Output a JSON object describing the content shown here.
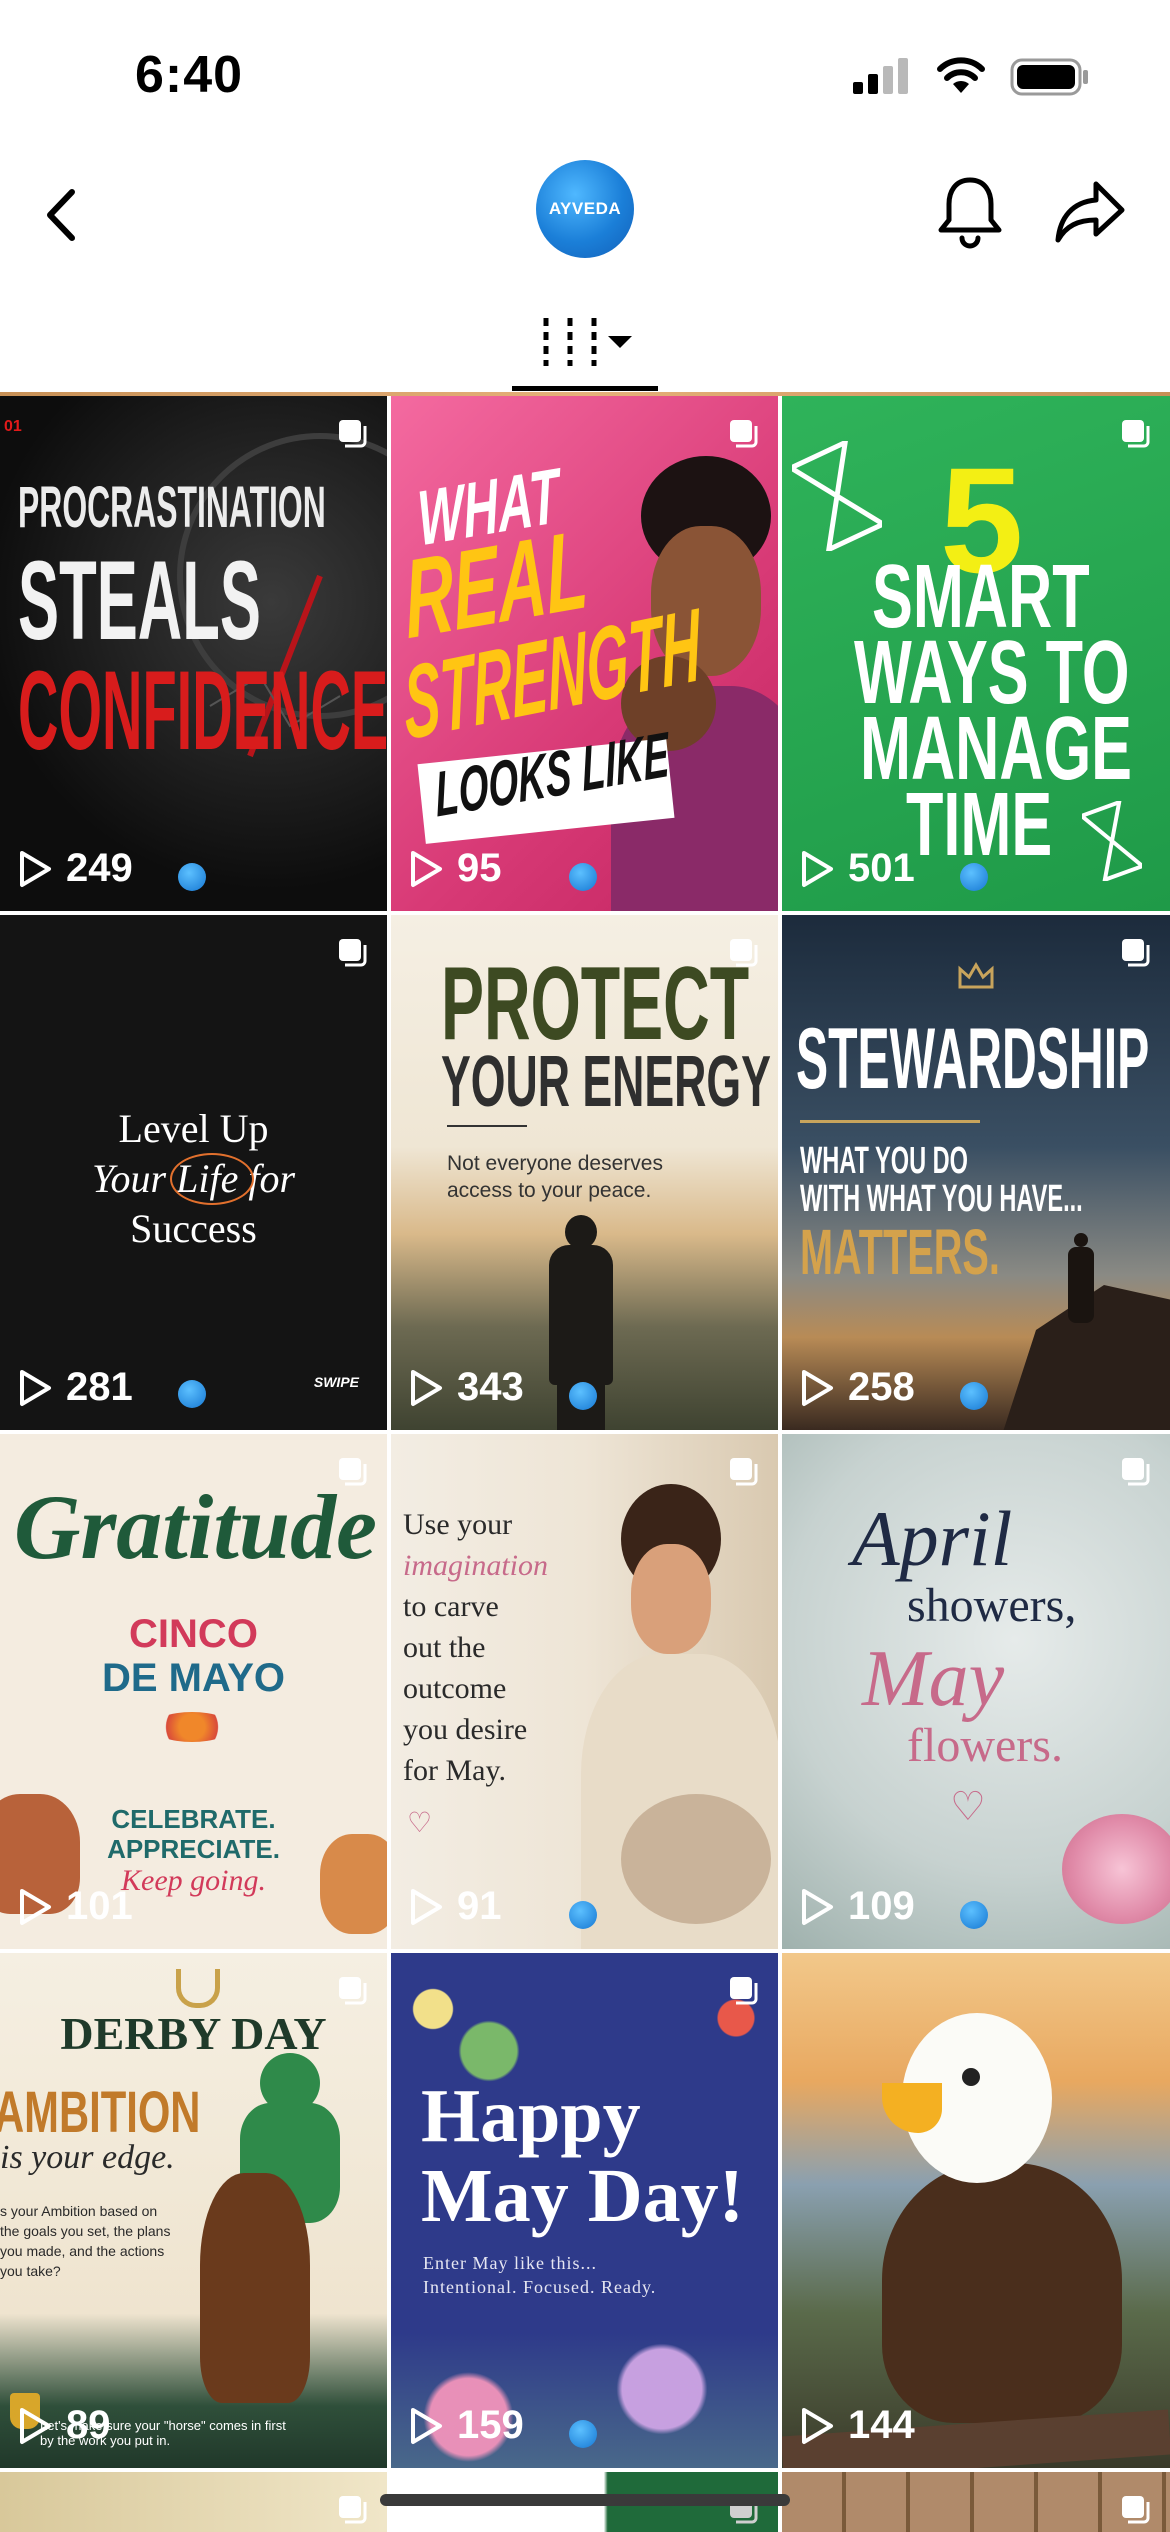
{
  "status_bar": {
    "time": "6:40"
  },
  "header": {
    "avatar_label": "AYVEDA"
  },
  "tiles": [
    {
      "lines": [
        "PROCRASTINATION",
        "STEALS",
        "CONFIDENCE."
      ],
      "corner": "01",
      "views": "249"
    },
    {
      "lines": [
        "WHAT",
        "REAL",
        "STRENGTH",
        "LOOKS LIKE"
      ],
      "views": "95"
    },
    {
      "lines": [
        "5",
        "SMART",
        "WAYS TO",
        "MANAGE",
        "TIME"
      ],
      "views": "501"
    },
    {
      "lines": [
        "Level Up",
        "Your Life for",
        "Success"
      ],
      "swipe": "SWIPE",
      "views": "281"
    },
    {
      "lines": [
        "PROTECT",
        "YOUR ENERGY",
        "Not everyone deserves",
        "access to your peace."
      ],
      "views": "343"
    },
    {
      "lines": [
        "STEWARDSHIP",
        "WHAT YOU DO",
        "WITH WHAT YOU HAVE...",
        "MATTERS."
      ],
      "views": "258"
    },
    {
      "lines": [
        "Gratitude",
        "CINCO",
        "DE MAYO",
        "CELEBRATE.",
        "APPRECIATE.",
        "Keep going."
      ],
      "views": "101"
    },
    {
      "lines": [
        "Use your",
        "imagination",
        "to carve",
        "out the",
        "outcome",
        "you desire",
        "for May."
      ],
      "views": "91"
    },
    {
      "lines": [
        "April",
        "showers,",
        "May",
        "flowers."
      ],
      "views": "109"
    },
    {
      "lines": [
        "DERBY DAY",
        "AMBITION",
        "is your edge.",
        "s your Ambition based on",
        "the goals you set, the plans",
        "you made, and the actions",
        "you take?",
        "Let's make sure your \"horse\" comes in first",
        "by the work you put in."
      ],
      "views": "89"
    },
    {
      "lines": [
        "Happy",
        "May Day!",
        "Enter May like this...",
        "Intentional. Focused. Ready."
      ],
      "views": "159"
    },
    {
      "lines": [],
      "views": "144"
    }
  ]
}
